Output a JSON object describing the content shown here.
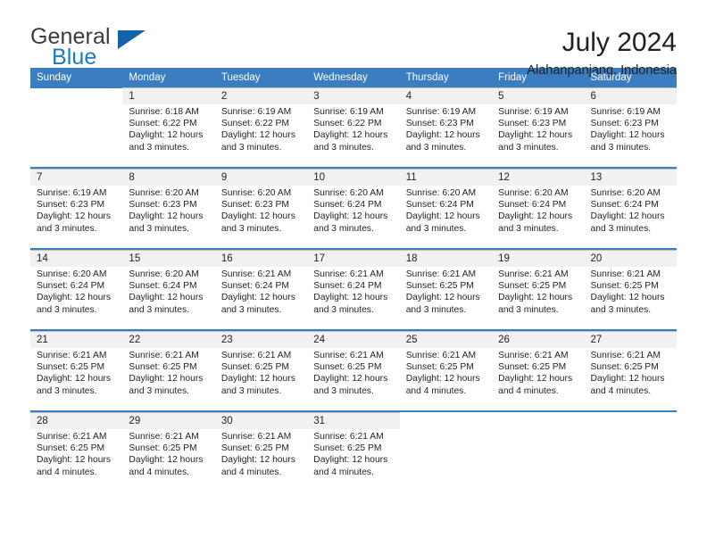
{
  "brand": {
    "name_top": "General",
    "name_bottom": "Blue",
    "triangle_color": "#1463a8",
    "blue_color": "#1f7bc1"
  },
  "header": {
    "month_title": "July 2024",
    "location": "Alahanpanjang, Indonesia",
    "accent_color": "#3a7dc0",
    "daynum_bg": "#f1f1f1"
  },
  "weekday_headers": [
    "Sunday",
    "Monday",
    "Tuesday",
    "Wednesday",
    "Thursday",
    "Friday",
    "Saturday"
  ],
  "weeks": [
    [
      {
        "day": "",
        "sunrise": "",
        "sunset": "",
        "daylight1": "",
        "daylight2": ""
      },
      {
        "day": "1",
        "sunrise": "Sunrise: 6:18 AM",
        "sunset": "Sunset: 6:22 PM",
        "daylight1": "Daylight: 12 hours",
        "daylight2": "and 3 minutes."
      },
      {
        "day": "2",
        "sunrise": "Sunrise: 6:19 AM",
        "sunset": "Sunset: 6:22 PM",
        "daylight1": "Daylight: 12 hours",
        "daylight2": "and 3 minutes."
      },
      {
        "day": "3",
        "sunrise": "Sunrise: 6:19 AM",
        "sunset": "Sunset: 6:22 PM",
        "daylight1": "Daylight: 12 hours",
        "daylight2": "and 3 minutes."
      },
      {
        "day": "4",
        "sunrise": "Sunrise: 6:19 AM",
        "sunset": "Sunset: 6:23 PM",
        "daylight1": "Daylight: 12 hours",
        "daylight2": "and 3 minutes."
      },
      {
        "day": "5",
        "sunrise": "Sunrise: 6:19 AM",
        "sunset": "Sunset: 6:23 PM",
        "daylight1": "Daylight: 12 hours",
        "daylight2": "and 3 minutes."
      },
      {
        "day": "6",
        "sunrise": "Sunrise: 6:19 AM",
        "sunset": "Sunset: 6:23 PM",
        "daylight1": "Daylight: 12 hours",
        "daylight2": "and 3 minutes."
      }
    ],
    [
      {
        "day": "7",
        "sunrise": "Sunrise: 6:19 AM",
        "sunset": "Sunset: 6:23 PM",
        "daylight1": "Daylight: 12 hours",
        "daylight2": "and 3 minutes."
      },
      {
        "day": "8",
        "sunrise": "Sunrise: 6:20 AM",
        "sunset": "Sunset: 6:23 PM",
        "daylight1": "Daylight: 12 hours",
        "daylight2": "and 3 minutes."
      },
      {
        "day": "9",
        "sunrise": "Sunrise: 6:20 AM",
        "sunset": "Sunset: 6:23 PM",
        "daylight1": "Daylight: 12 hours",
        "daylight2": "and 3 minutes."
      },
      {
        "day": "10",
        "sunrise": "Sunrise: 6:20 AM",
        "sunset": "Sunset: 6:24 PM",
        "daylight1": "Daylight: 12 hours",
        "daylight2": "and 3 minutes."
      },
      {
        "day": "11",
        "sunrise": "Sunrise: 6:20 AM",
        "sunset": "Sunset: 6:24 PM",
        "daylight1": "Daylight: 12 hours",
        "daylight2": "and 3 minutes."
      },
      {
        "day": "12",
        "sunrise": "Sunrise: 6:20 AM",
        "sunset": "Sunset: 6:24 PM",
        "daylight1": "Daylight: 12 hours",
        "daylight2": "and 3 minutes."
      },
      {
        "day": "13",
        "sunrise": "Sunrise: 6:20 AM",
        "sunset": "Sunset: 6:24 PM",
        "daylight1": "Daylight: 12 hours",
        "daylight2": "and 3 minutes."
      }
    ],
    [
      {
        "day": "14",
        "sunrise": "Sunrise: 6:20 AM",
        "sunset": "Sunset: 6:24 PM",
        "daylight1": "Daylight: 12 hours",
        "daylight2": "and 3 minutes."
      },
      {
        "day": "15",
        "sunrise": "Sunrise: 6:20 AM",
        "sunset": "Sunset: 6:24 PM",
        "daylight1": "Daylight: 12 hours",
        "daylight2": "and 3 minutes."
      },
      {
        "day": "16",
        "sunrise": "Sunrise: 6:21 AM",
        "sunset": "Sunset: 6:24 PM",
        "daylight1": "Daylight: 12 hours",
        "daylight2": "and 3 minutes."
      },
      {
        "day": "17",
        "sunrise": "Sunrise: 6:21 AM",
        "sunset": "Sunset: 6:24 PM",
        "daylight1": "Daylight: 12 hours",
        "daylight2": "and 3 minutes."
      },
      {
        "day": "18",
        "sunrise": "Sunrise: 6:21 AM",
        "sunset": "Sunset: 6:25 PM",
        "daylight1": "Daylight: 12 hours",
        "daylight2": "and 3 minutes."
      },
      {
        "day": "19",
        "sunrise": "Sunrise: 6:21 AM",
        "sunset": "Sunset: 6:25 PM",
        "daylight1": "Daylight: 12 hours",
        "daylight2": "and 3 minutes."
      },
      {
        "day": "20",
        "sunrise": "Sunrise: 6:21 AM",
        "sunset": "Sunset: 6:25 PM",
        "daylight1": "Daylight: 12 hours",
        "daylight2": "and 3 minutes."
      }
    ],
    [
      {
        "day": "21",
        "sunrise": "Sunrise: 6:21 AM",
        "sunset": "Sunset: 6:25 PM",
        "daylight1": "Daylight: 12 hours",
        "daylight2": "and 3 minutes."
      },
      {
        "day": "22",
        "sunrise": "Sunrise: 6:21 AM",
        "sunset": "Sunset: 6:25 PM",
        "daylight1": "Daylight: 12 hours",
        "daylight2": "and 3 minutes."
      },
      {
        "day": "23",
        "sunrise": "Sunrise: 6:21 AM",
        "sunset": "Sunset: 6:25 PM",
        "daylight1": "Daylight: 12 hours",
        "daylight2": "and 3 minutes."
      },
      {
        "day": "24",
        "sunrise": "Sunrise: 6:21 AM",
        "sunset": "Sunset: 6:25 PM",
        "daylight1": "Daylight: 12 hours",
        "daylight2": "and 3 minutes."
      },
      {
        "day": "25",
        "sunrise": "Sunrise: 6:21 AM",
        "sunset": "Sunset: 6:25 PM",
        "daylight1": "Daylight: 12 hours",
        "daylight2": "and 4 minutes."
      },
      {
        "day": "26",
        "sunrise": "Sunrise: 6:21 AM",
        "sunset": "Sunset: 6:25 PM",
        "daylight1": "Daylight: 12 hours",
        "daylight2": "and 4 minutes."
      },
      {
        "day": "27",
        "sunrise": "Sunrise: 6:21 AM",
        "sunset": "Sunset: 6:25 PM",
        "daylight1": "Daylight: 12 hours",
        "daylight2": "and 4 minutes."
      }
    ],
    [
      {
        "day": "28",
        "sunrise": "Sunrise: 6:21 AM",
        "sunset": "Sunset: 6:25 PM",
        "daylight1": "Daylight: 12 hours",
        "daylight2": "and 4 minutes."
      },
      {
        "day": "29",
        "sunrise": "Sunrise: 6:21 AM",
        "sunset": "Sunset: 6:25 PM",
        "daylight1": "Daylight: 12 hours",
        "daylight2": "and 4 minutes."
      },
      {
        "day": "30",
        "sunrise": "Sunrise: 6:21 AM",
        "sunset": "Sunset: 6:25 PM",
        "daylight1": "Daylight: 12 hours",
        "daylight2": "and 4 minutes."
      },
      {
        "day": "31",
        "sunrise": "Sunrise: 6:21 AM",
        "sunset": "Sunset: 6:25 PM",
        "daylight1": "Daylight: 12 hours",
        "daylight2": "and 4 minutes."
      },
      {
        "day": "",
        "sunrise": "",
        "sunset": "",
        "daylight1": "",
        "daylight2": ""
      },
      {
        "day": "",
        "sunrise": "",
        "sunset": "",
        "daylight1": "",
        "daylight2": ""
      },
      {
        "day": "",
        "sunrise": "",
        "sunset": "",
        "daylight1": "",
        "daylight2": ""
      }
    ]
  ]
}
